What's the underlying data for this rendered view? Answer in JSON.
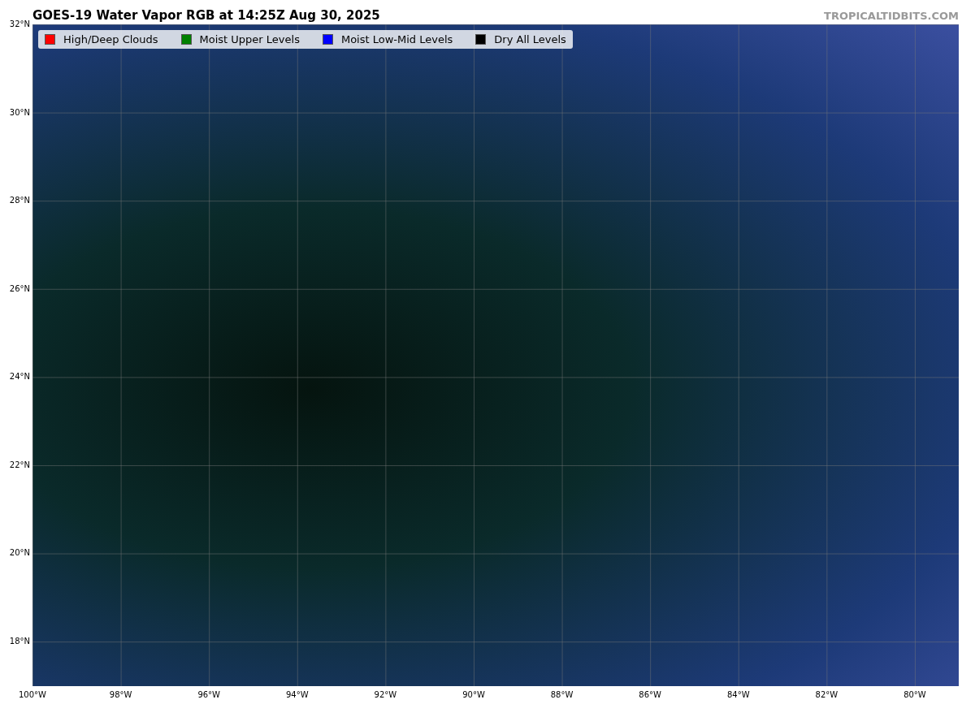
{
  "title": "GOES-19 Water Vapor RGB at 14:25Z Aug 30, 2025",
  "brand": "TROPICALTIDBITS.COM",
  "legend": [
    {
      "label": "High/Deep Clouds",
      "color": "#ff0000"
    },
    {
      "label": "Moist Upper Levels",
      "color": "#008000"
    },
    {
      "label": "Moist Low-Mid Levels",
      "color": "#0000ff"
    },
    {
      "label": "Dry All Levels",
      "color": "#000000"
    }
  ],
  "y_ticks": [
    "32°N",
    "30°N",
    "28°N",
    "26°N",
    "24°N",
    "22°N",
    "20°N",
    "18°N"
  ],
  "x_ticks": [
    "100°W",
    "98°W",
    "96°W",
    "94°W",
    "92°W",
    "90°W",
    "88°W",
    "86°W",
    "84°W",
    "82°W",
    "80°W"
  ]
}
